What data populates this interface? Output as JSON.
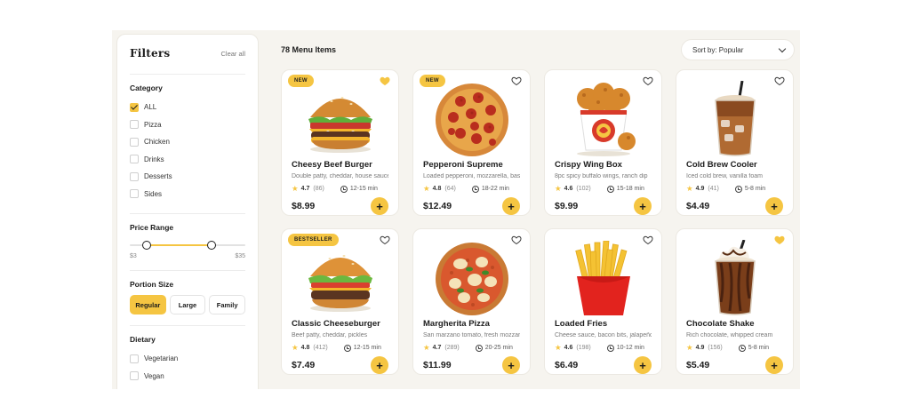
{
  "filters": {
    "title": "Filters",
    "clear_all": "Clear all",
    "category": {
      "title": "Category",
      "items": [
        {
          "label": "ALL",
          "checked": true
        },
        {
          "label": "Pizza",
          "checked": false
        },
        {
          "label": "Chicken",
          "checked": false
        },
        {
          "label": "Drinks",
          "checked": false
        },
        {
          "label": "Desserts",
          "checked": false
        },
        {
          "label": "Sides",
          "checked": false
        }
      ]
    },
    "price_range": {
      "title": "Price Range",
      "min_label": "$3",
      "max_label": "$35"
    },
    "portion_size": {
      "title": "Portion Size",
      "options": [
        "Regular",
        "Large",
        "Family"
      ],
      "selected": "Regular"
    },
    "dietary": {
      "title": "Dietary",
      "items": [
        {
          "label": "Vegetarian",
          "checked": false
        },
        {
          "label": "Vegan",
          "checked": false
        }
      ]
    }
  },
  "header": {
    "count": "78 Menu Items",
    "sort": "Sort by: Popular"
  },
  "colors": {
    "accent": "#f5c542",
    "background": "#f6f4ef"
  },
  "items": [
    {
      "badge": "NEW",
      "favorited": true,
      "image": "burger-image",
      "name": "Cheesy Beef Burger",
      "desc": "Double patty, cheddar, house sauce",
      "rating": "4.7",
      "reviews": "(86)",
      "time": "12-15 min",
      "price": "$8.99"
    },
    {
      "badge": "NEW",
      "favorited": false,
      "image": "pepperoni-pizza-image",
      "name": "Pepperoni Supreme",
      "desc": "Loaded pepperoni, mozzarella, basil",
      "rating": "4.8",
      "reviews": "(64)",
      "time": "18-22 min",
      "price": "$12.49"
    },
    {
      "badge": "",
      "favorited": false,
      "image": "fried-chicken-bucket-image",
      "name": "Crispy Wing Box",
      "desc": "8pc spicy buffalo wings, ranch dip",
      "rating": "4.6",
      "reviews": "(102)",
      "time": "15-18 min",
      "price": "$9.99"
    },
    {
      "badge": "",
      "favorited": false,
      "image": "iced-coffee-image",
      "name": "Cold Brew Cooler",
      "desc": "Iced cold brew, vanilla foam",
      "rating": "4.9",
      "reviews": "(41)",
      "time": "5-8 min",
      "price": "$4.49"
    },
    {
      "badge": "BESTSELLER",
      "favorited": false,
      "image": "cheeseburger-image",
      "name": "Classic Cheeseburger",
      "desc": "Beef patty, cheddar, pickles",
      "rating": "4.8",
      "reviews": "(412)",
      "time": "12-15 min",
      "price": "$7.49"
    },
    {
      "badge": "",
      "favorited": false,
      "image": "margherita-pizza-image",
      "name": "Margherita Pizza",
      "desc": "San marzano tomato, fresh mozzarella",
      "rating": "4.7",
      "reviews": "(289)",
      "time": "20-25 min",
      "price": "$11.99"
    },
    {
      "badge": "",
      "favorited": false,
      "image": "fries-image",
      "name": "Loaded Fries",
      "desc": "Cheese sauce, bacon bits, jalapeños",
      "rating": "4.6",
      "reviews": "(198)",
      "time": "10-12 min",
      "price": "$6.49"
    },
    {
      "badge": "",
      "favorited": true,
      "image": "chocolate-shake-image",
      "name": "Chocolate Shake",
      "desc": "Rich chocolate, whipped cream",
      "rating": "4.9",
      "reviews": "(156)",
      "time": "5-8 min",
      "price": "$5.49"
    }
  ]
}
